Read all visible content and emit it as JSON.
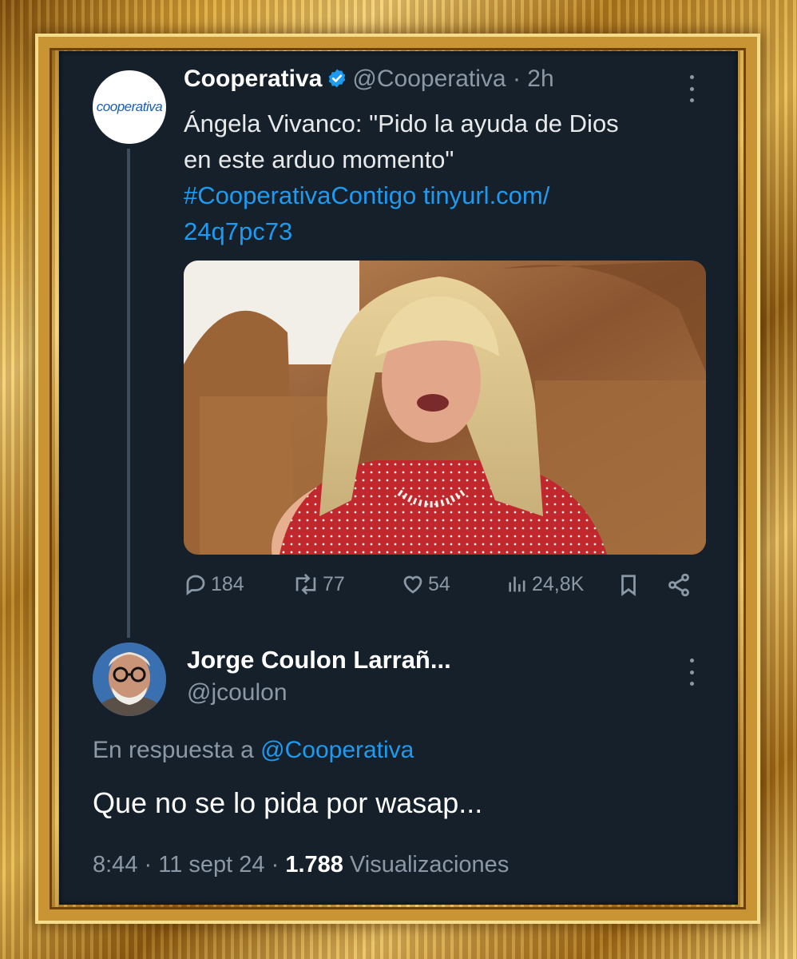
{
  "tweet": {
    "author_name": "Cooperativa",
    "avatar_text": "cooperativa",
    "handle": "@Cooperativa",
    "separator": "·",
    "time": "2h",
    "text_line1": "Ángela Vivanco: \"Pido la ayuda de Dios",
    "text_line2": "en este arduo momento\"",
    "hashtag": "#CooperativaContigo",
    "link_part1": "tinyurl.com/",
    "link_part2": "24q7pc73",
    "stats": {
      "replies": "184",
      "retweets": "77",
      "likes": "54",
      "views": "24,8K"
    }
  },
  "reply": {
    "author_name": "Jorge Coulon Larrañ...",
    "handle": "@jcoulon",
    "in_reply_prefix": "En respuesta a",
    "in_reply_handle": "@Cooperativa",
    "text": "Que no se lo pida por wasap...",
    "time": "8:44",
    "date": "11 sept 24",
    "views_count": "1.788",
    "views_label": "Visualizaciones"
  },
  "colors": {
    "background": "#15202b",
    "accent": "#1d9bf0",
    "muted": "#8b98a5",
    "frame_gold": "#c99433"
  },
  "icons": [
    "verified-badge-icon",
    "more-options-icon",
    "reply-icon",
    "retweet-icon",
    "like-icon",
    "views-icon",
    "bookmark-icon",
    "share-icon"
  ]
}
